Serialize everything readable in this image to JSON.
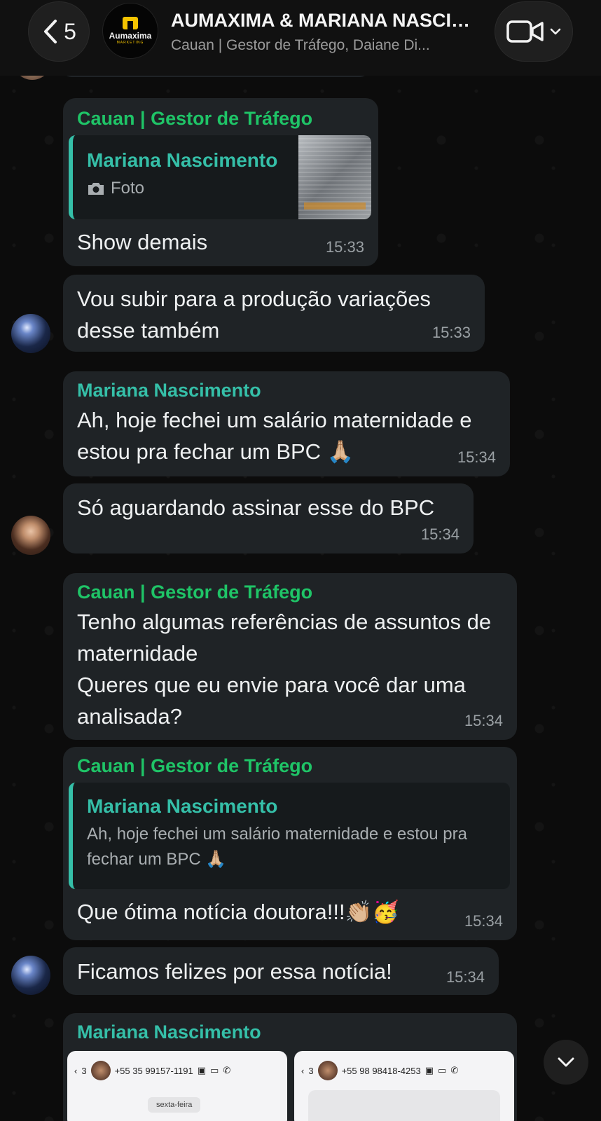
{
  "header": {
    "back_count": "5",
    "title": "AUMAXIMA & MARIANA NASCIMENTO",
    "subtitle": "Cauan | Gestor de Tráfego, Daiane Di...",
    "logo_text": "Aumaxima",
    "logo_sub": "MARKETING"
  },
  "messages": [
    {
      "sender": "Cauan | Gestor de Tráfego",
      "quote_sender": "Mariana Nascimento",
      "quote_text": "Foto",
      "text": "Show demais",
      "time": "15:33"
    },
    {
      "text": "Vou subir para a produção variações desse também",
      "time": "15:33"
    },
    {
      "sender": "Mariana Nascimento",
      "text": "Ah, hoje fechei um salário maternidade e estou pra fechar um BPC 🙏🏼",
      "time": "15:34"
    },
    {
      "text": "Só aguardando assinar esse do BPC",
      "time": "15:34"
    },
    {
      "sender": "Cauan | Gestor de Tráfego",
      "text_line1": "Tenho algumas referências de assuntos de maternidade",
      "text_line2": "Queres que eu envie para você dar uma analisada?",
      "time": "15:34"
    },
    {
      "sender": "Cauan | Gestor de Tráfego",
      "quote_sender": "Mariana Nascimento",
      "quote_text": "Ah, hoje fechei um salário maternidade e estou pra fechar um BPC 🙏🏼",
      "text": "Que ótima notícia doutora!!!👏🏼🥳",
      "time": "15:34"
    },
    {
      "text": "Ficamos felizes por essa notícia!",
      "time": "15:34"
    },
    {
      "sender": "Mariana Nascimento",
      "screenshots": [
        {
          "back": "3",
          "phone": "+55 35 99157-1191",
          "chip": "sexta-feira"
        },
        {
          "back": "3",
          "phone": "+55 98 98418-4253"
        }
      ]
    }
  ]
}
